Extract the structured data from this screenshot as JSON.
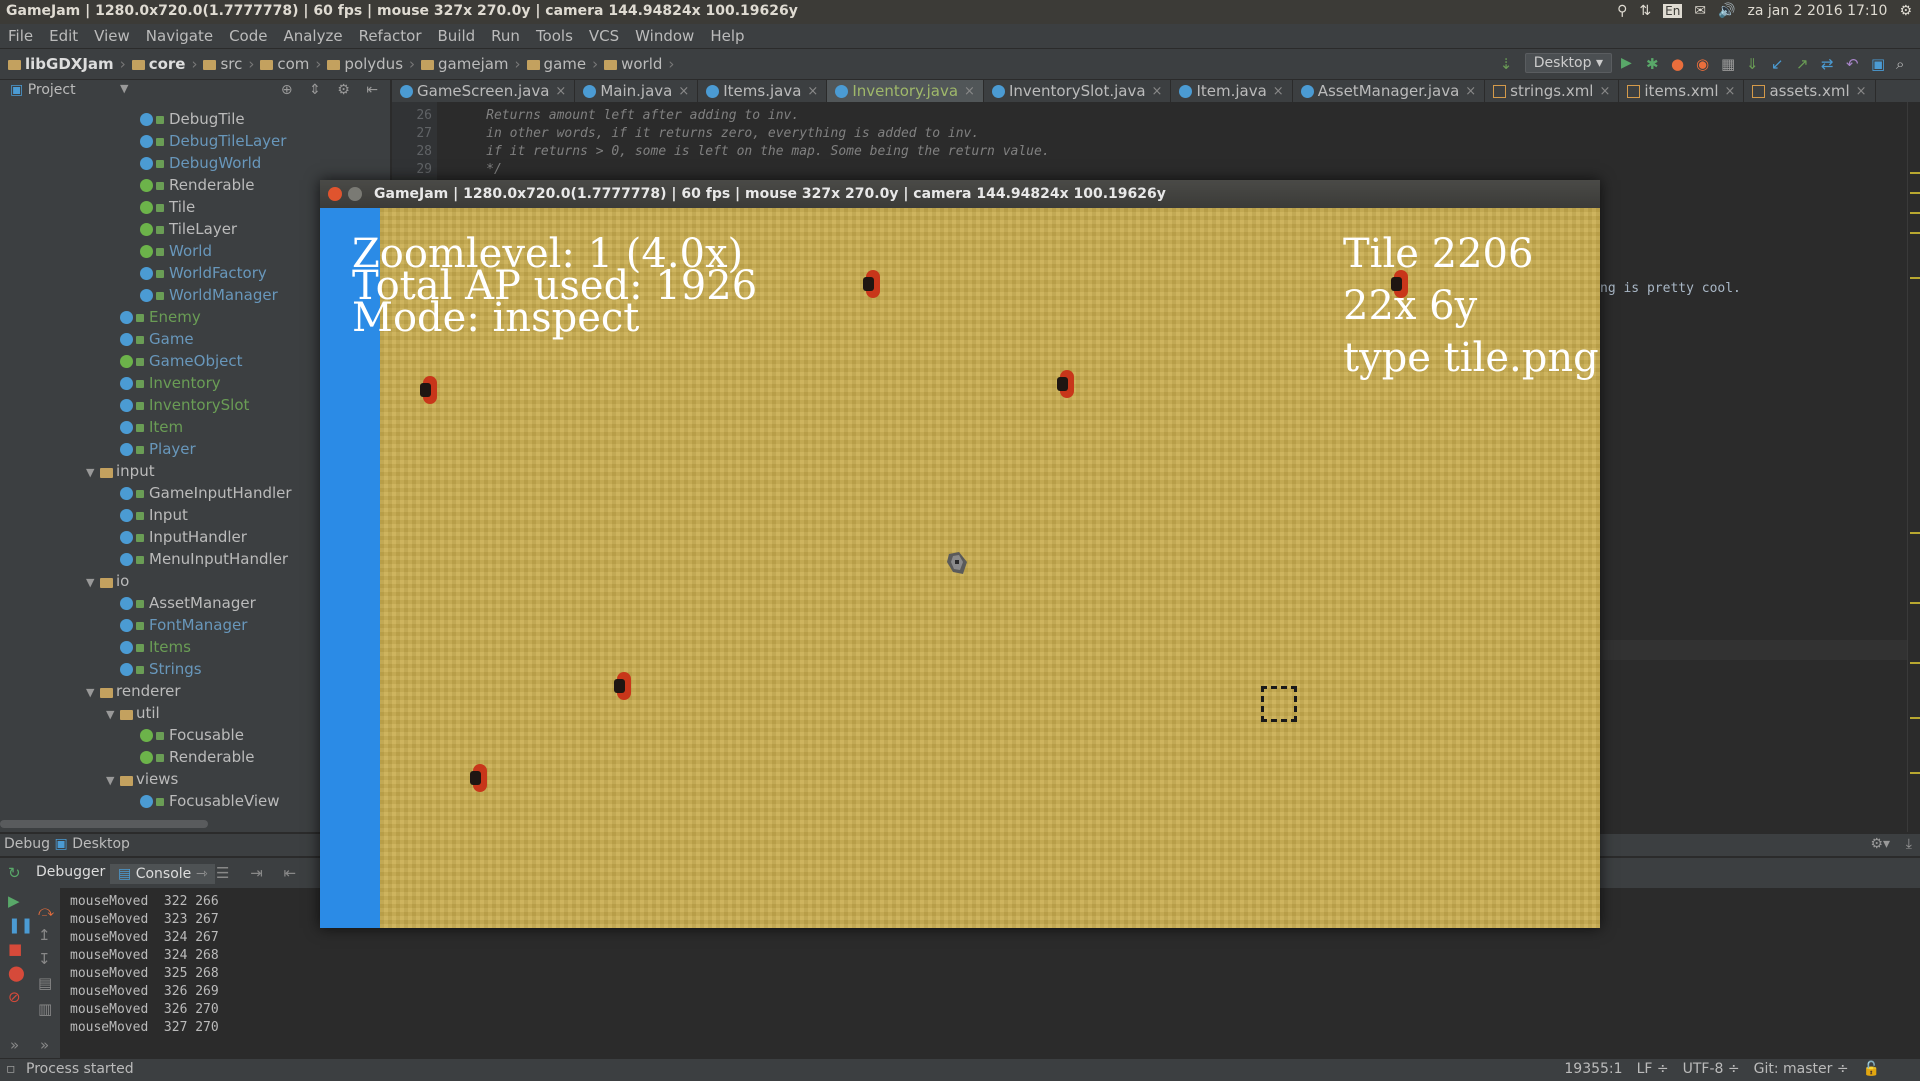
{
  "system_bar": {
    "title": "GameJam | 1280.0x720.0(1.7777778) | 60 fps | mouse 327x 270.0y | camera 144.94824x 100.19626y",
    "keyboard": "En",
    "datetime": "za jan 2 2016 17:10"
  },
  "menu": [
    "File",
    "Edit",
    "View",
    "Navigate",
    "Code",
    "Analyze",
    "Refactor",
    "Build",
    "Run",
    "Tools",
    "VCS",
    "Window",
    "Help"
  ],
  "breadcrumb": [
    "libGDXJam",
    "core",
    "src",
    "com",
    "polydus",
    "gamejam",
    "game",
    "world"
  ],
  "run_config": "Desktop",
  "project_panel": {
    "label": "Project"
  },
  "tabs": [
    {
      "label": "GameScreen.java",
      "type": "class",
      "active": false
    },
    {
      "label": "Main.java",
      "type": "class",
      "active": false
    },
    {
      "label": "Items.java",
      "type": "class",
      "active": false
    },
    {
      "label": "Inventory.java",
      "type": "class",
      "active": true
    },
    {
      "label": "InventorySlot.java",
      "type": "class",
      "active": false
    },
    {
      "label": "Item.java",
      "type": "class",
      "active": false
    },
    {
      "label": "AssetManager.java",
      "type": "class",
      "active": false
    },
    {
      "label": "strings.xml",
      "type": "xml",
      "active": false
    },
    {
      "label": "items.xml",
      "type": "xml",
      "active": false
    },
    {
      "label": "assets.xml",
      "type": "xml",
      "active": false
    }
  ],
  "tree": [
    {
      "label": "DebugTile",
      "kind": "class",
      "color": "normal",
      "indent": 3
    },
    {
      "label": "DebugTileLayer",
      "kind": "class",
      "color": "blue",
      "indent": 3
    },
    {
      "label": "DebugWorld",
      "kind": "class",
      "color": "blue",
      "indent": 3
    },
    {
      "label": "Renderable",
      "kind": "iface",
      "color": "normal",
      "indent": 3
    },
    {
      "label": "Tile",
      "kind": "iface",
      "color": "normal",
      "indent": 3
    },
    {
      "label": "TileLayer",
      "kind": "iface",
      "color": "normal",
      "indent": 3
    },
    {
      "label": "World",
      "kind": "iface",
      "color": "blue",
      "indent": 3
    },
    {
      "label": "WorldFactory",
      "kind": "class",
      "color": "blue",
      "indent": 3
    },
    {
      "label": "WorldManager",
      "kind": "class",
      "color": "blue",
      "indent": 3
    },
    {
      "label": "Enemy",
      "kind": "class",
      "color": "green",
      "indent": 2
    },
    {
      "label": "Game",
      "kind": "class",
      "color": "blue",
      "indent": 2
    },
    {
      "label": "GameObject",
      "kind": "iface",
      "color": "blue",
      "indent": 2
    },
    {
      "label": "Inventory",
      "kind": "class",
      "color": "green",
      "indent": 2
    },
    {
      "label": "InventorySlot",
      "kind": "class",
      "color": "green",
      "indent": 2
    },
    {
      "label": "Item",
      "kind": "class",
      "color": "green",
      "indent": 2
    },
    {
      "label": "Player",
      "kind": "class",
      "color": "blue",
      "indent": 2
    },
    {
      "label": "input",
      "kind": "pkg",
      "color": "normal",
      "indent": 1,
      "open": true
    },
    {
      "label": "GameInputHandler",
      "kind": "class",
      "color": "normal",
      "indent": 2
    },
    {
      "label": "Input",
      "kind": "class",
      "color": "normal",
      "indent": 2
    },
    {
      "label": "InputHandler",
      "kind": "class",
      "color": "normal",
      "indent": 2
    },
    {
      "label": "MenuInputHandler",
      "kind": "class",
      "color": "normal",
      "indent": 2
    },
    {
      "label": "io",
      "kind": "pkg",
      "color": "normal",
      "indent": 1,
      "open": true
    },
    {
      "label": "AssetManager",
      "kind": "class",
      "color": "normal",
      "indent": 2
    },
    {
      "label": "FontManager",
      "kind": "class",
      "color": "blue",
      "indent": 2
    },
    {
      "label": "Items",
      "kind": "class",
      "color": "green",
      "indent": 2
    },
    {
      "label": "Strings",
      "kind": "class",
      "color": "blue",
      "indent": 2
    },
    {
      "label": "renderer",
      "kind": "pkg",
      "color": "normal",
      "indent": 1,
      "open": true
    },
    {
      "label": "util",
      "kind": "pkg",
      "color": "normal",
      "indent": 2,
      "open": true
    },
    {
      "label": "Focusable",
      "kind": "iface",
      "color": "normal",
      "indent": 3
    },
    {
      "label": "Renderable",
      "kind": "iface",
      "color": "normal",
      "indent": 3
    },
    {
      "label": "views",
      "kind": "pkg",
      "color": "normal",
      "indent": 2,
      "open": true
    },
    {
      "label": "FocusableView",
      "kind": "class",
      "color": "normal",
      "indent": 3
    }
  ],
  "code": [
    {
      "line": "26",
      "text": "     Returns amount left after adding to inv."
    },
    {
      "line": "27",
      "text": "     in other words, if it returns zero, everything is added to inv."
    },
    {
      "line": "28",
      "text": "     if it returns > 0, some is left on the map. Some being the return value."
    },
    {
      "line": "29",
      "text": "     */"
    }
  ],
  "code_right_fragment": "ng is pretty cool.",
  "debug": {
    "panel_label": "Debug",
    "config": "Desktop",
    "tab_debugger": "Debugger",
    "tab_console": "Console"
  },
  "console_lines": [
    "mouseMoved  322 266",
    "mouseMoved  323 267",
    "mouseMoved  324 267",
    "mouseMoved  324 268",
    "mouseMoved  325 268",
    "mouseMoved  326 269",
    "mouseMoved  326 270",
    "mouseMoved  327 270"
  ],
  "status": {
    "message": "Process started",
    "position": "19355:1",
    "line_sep": "LF",
    "encoding": "UTF-8",
    "vcs": "Git: master"
  },
  "game": {
    "window_title": "GameJam | 1280.0x720.0(1.7777778) | 60 fps | mouse 327x 270.0y | camera 144.94824x 100.19626y",
    "hud_zoom": "Zoomlevel: 1 (4.0x)",
    "hud_ap": "Total AP used: 1926",
    "hud_mode": "Mode: inspect",
    "tile_id": "Tile 2206",
    "tile_pos": "22x 6y",
    "tile_type": "type tile.png",
    "colors": {
      "sand": "#c9ad4f",
      "left_strip": "#2b8be6",
      "enemy": "#c8361a"
    }
  }
}
